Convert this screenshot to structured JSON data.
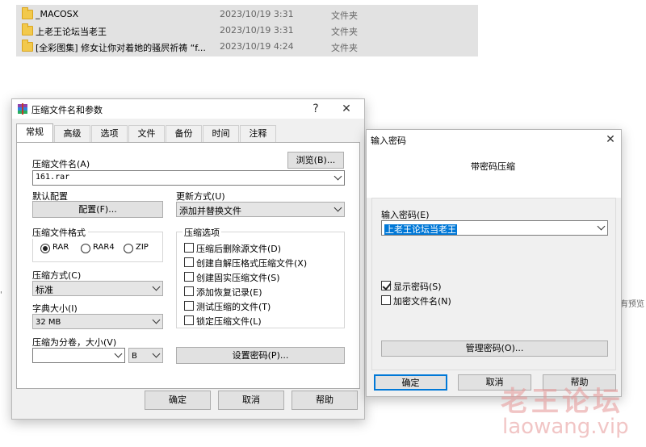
{
  "explorer": {
    "files": [
      {
        "name": "_MACOSX",
        "date": "2023/10/19 3:31",
        "type": "文件夹"
      },
      {
        "name": "上老王论坛当老王",
        "date": "2023/10/19 3:31",
        "type": "文件夹"
      },
      {
        "name": "[全彩图集] 修女让你对着她的骚屄祈祷 “f...",
        "date": "2023/10/19 4:24",
        "type": "文件夹"
      }
    ],
    "side_left_text": "'",
    "side_right_text": "有预览"
  },
  "archive_dialog": {
    "title": "压缩文件名和参数",
    "help_glyph": "?",
    "close_glyph": "✕",
    "tabs": [
      "常规",
      "高级",
      "选项",
      "文件",
      "备份",
      "时间",
      "注释"
    ],
    "archive_name_label": "压缩文件名(A)",
    "browse_button": "浏览(B)...",
    "archive_name_value": "161.rar",
    "default_profile_label": "默认配置",
    "profiles_button": "配置(F)...",
    "update_mode_label": "更新方式(U)",
    "update_mode_value": "添加并替换文件",
    "format_label": "压缩文件格式",
    "formats": [
      "RAR",
      "RAR4",
      "ZIP"
    ],
    "method_label": "压缩方式(C)",
    "method_value": "标准",
    "dict_label": "字典大小(I)",
    "dict_value": "32 MB",
    "split_label": "压缩为分卷，大小(V)",
    "split_value": "",
    "split_unit": "B",
    "options_label": "压缩选项",
    "options": [
      {
        "label": "压缩后删除源文件(D)",
        "checked": false
      },
      {
        "label": "创建自解压格式压缩文件(X)",
        "checked": false
      },
      {
        "label": "创建固实压缩文件(S)",
        "checked": false
      },
      {
        "label": "添加恢复记录(E)",
        "checked": false
      },
      {
        "label": "测试压缩的文件(T)",
        "checked": false
      },
      {
        "label": "锁定压缩文件(L)",
        "checked": false
      }
    ],
    "set_password_button": "设置密码(P)...",
    "ok_button": "确定",
    "cancel_button": "取消",
    "help_button": "帮助"
  },
  "password_dialog": {
    "title": "输入密码",
    "close_glyph": "✕",
    "heading": "带密码压缩",
    "password_label": "输入密码(E)",
    "password_value": "上老王论坛当老王",
    "show_password_label": "显示密码(S)",
    "show_password_checked": true,
    "encrypt_names_label": "加密文件名(N)",
    "encrypt_names_checked": false,
    "organize_button": "管理密码(O)...",
    "ok_button": "确定",
    "cancel_button": "取消",
    "help_button": "帮助"
  },
  "watermark": {
    "line1": "老王论坛",
    "line2": "laowang.vip"
  },
  "colors": {
    "selection": "#0078d7",
    "folder": "#f2c94c",
    "explorer_highlight": "#e2e2e2"
  }
}
